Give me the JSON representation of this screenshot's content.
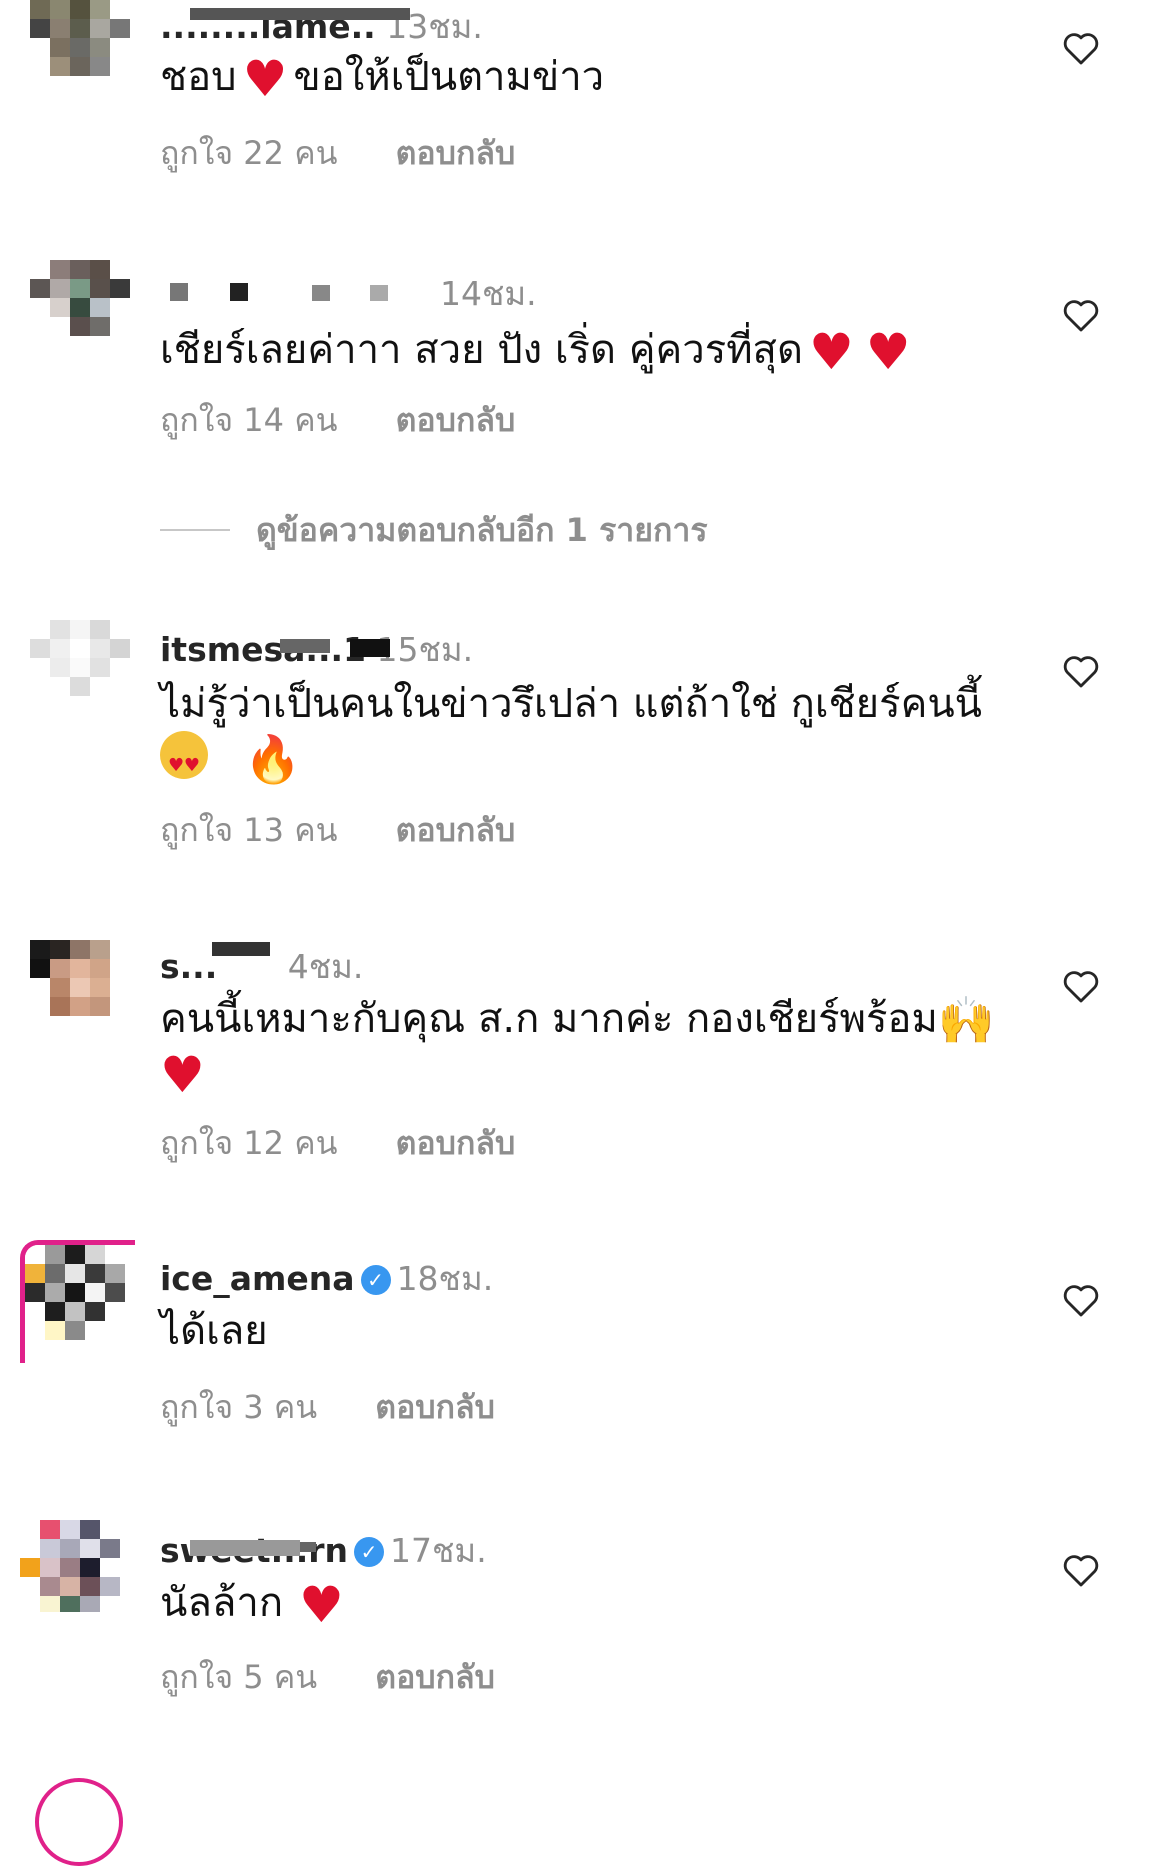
{
  "comments": [
    {
      "username": "........iame..",
      "time": "13ชม.",
      "text": "ชอบ",
      "text_after": "ขอให้เป็นตามข่าว",
      "emojis": [
        "heart"
      ],
      "likes_label": "ถูกใจ 22 คน",
      "reply_label": "ตอบกลับ"
    },
    {
      "username": "",
      "time": "14ชม.",
      "text": "เชียร์เลยค่าาา สวย ปัง เริ่ด คู่ควรที่สุด",
      "emojis": [
        "heart",
        "heart"
      ],
      "likes_label": "ถูกใจ 14 คน",
      "reply_label": "ตอบกลับ"
    },
    {
      "username": "itsmesa...1",
      "time": "15ชม.",
      "text": "ไม่รู้ว่าเป็นคนในข่าวรึเปล่า แต่ถ้าใช่ กูเชียร์คนนี้",
      "emojis": [
        "heart-eyes",
        "fire"
      ],
      "likes_label": "ถูกใจ 13 คน",
      "reply_label": "ตอบกลับ"
    },
    {
      "username": "s...",
      "time": "4ชม.",
      "text": "คนนี้เหมาะกับคุณ ส.ก มากค่ะ กองเชียร์พร้อม",
      "emojis": [
        "raised-hands",
        "heart"
      ],
      "likes_label": "ถูกใจ 12 คน",
      "reply_label": "ตอบกลับ"
    },
    {
      "username": "ice_amena",
      "verified": true,
      "time": "18ชม.",
      "text": "ได้เลย",
      "emojis": [],
      "likes_label": "ถูกใจ 3 คน",
      "reply_label": "ตอบกลับ"
    },
    {
      "username": "sweet...rn",
      "verified": true,
      "time": "17ชม.",
      "text": "นัลล้าก",
      "emojis": [
        "heart"
      ],
      "likes_label": "ถูกใจ 5 คน",
      "reply_label": "ตอบกลับ"
    }
  ],
  "more_replies_label": "ดูข้อความตอบกลับอีก 1 รายการ",
  "icons": {
    "like": "heart-outline-icon",
    "verified": "verified-badge-icon"
  },
  "colors": {
    "muted": "#8e8e8e",
    "heart": "#e0102e",
    "verified": "#3897f0",
    "ring": "#e0218a"
  }
}
